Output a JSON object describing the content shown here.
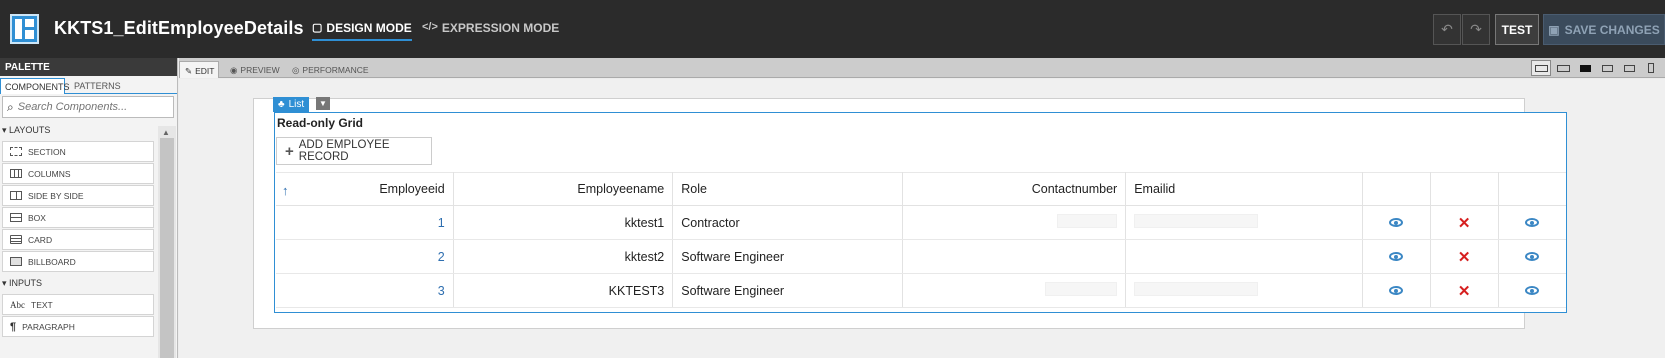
{
  "header": {
    "app_title": "KKTS1_EditEmployeeDetails",
    "design_mode_label": "DESIGN MODE",
    "expression_mode_label": "EXPRESSION MODE",
    "test_label": "TEST",
    "save_label": "SAVE CHANGES"
  },
  "palette": {
    "title": "PALETTE",
    "tabs": [
      "COMPONENTS",
      "PATTERNS"
    ],
    "search_placeholder": "Search Components...",
    "sections": {
      "layouts": "LAYOUTS",
      "inputs": "INPUTS"
    },
    "layout_items": [
      "SECTION",
      "COLUMNS",
      "SIDE BY SIDE",
      "BOX",
      "CARD",
      "BILLBOARD"
    ],
    "input_items": [
      "TEXT",
      "PARAGRAPH"
    ],
    "text_icon_label": "Abc"
  },
  "canvas_tabs": [
    "EDIT",
    "PREVIEW",
    "PERFORMANCE"
  ],
  "component": {
    "tag_label": "List",
    "grid_label": "Read-only Grid",
    "add_button_label": "ADD EMPLOYEE RECORD"
  },
  "grid": {
    "columns": [
      "Employeeid",
      "Employeename",
      "Role",
      "Contactnumber",
      "Emailid"
    ],
    "rows": [
      {
        "id": "1",
        "name": "kktest1",
        "role": "Contractor"
      },
      {
        "id": "2",
        "name": "kktest2",
        "role": "Software Engineer"
      },
      {
        "id": "3",
        "name": "KKTEST3",
        "role": "Software Engineer"
      }
    ]
  },
  "colors": {
    "accent": "#2f8fd4",
    "header_bg": "#2b2b2b",
    "delete_red": "#d61f1f"
  }
}
